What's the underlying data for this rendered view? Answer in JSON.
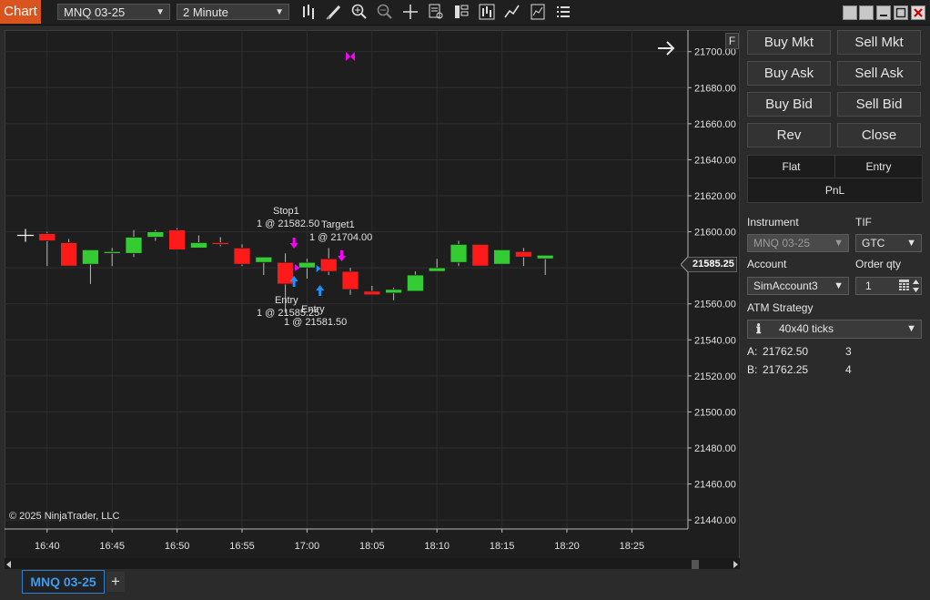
{
  "app": {
    "window_tag": "Chart"
  },
  "toolbar": {
    "instrument": "MNQ 03-25",
    "interval": "2 Minute",
    "icons": [
      "bar-type-icon",
      "draw-pencil-icon",
      "zoom-in-icon",
      "zoom-out-icon",
      "crosshair-icon",
      "data-box-icon",
      "properties-icon",
      "chart-trader-icon",
      "strategies-icon",
      "indicators-icon",
      "menu-list-icon"
    ]
  },
  "window_controls": [
    "window-tile-icon",
    "window-tile-icon",
    "minimize-icon",
    "maximize-icon",
    "close-icon"
  ],
  "chart": {
    "flag_button": "F",
    "copyright": "© 2025 NinjaTrader, LLC",
    "current_price_label": "21585.25",
    "y_ticks": [
      "21700.00",
      "21680.00",
      "21660.00",
      "21640.00",
      "21620.00",
      "21600.00",
      "21580.00",
      "21560.00",
      "21540.00",
      "21520.00",
      "21500.00",
      "21480.00",
      "21460.00",
      "21440.00"
    ],
    "x_ticks": [
      "16:40",
      "16:45",
      "16:50",
      "16:55",
      "17:00",
      "18:05",
      "18:10",
      "18:15",
      "18:20",
      "18:25"
    ],
    "annotations": {
      "stop1_title": "Stop1",
      "stop1_detail": "1 @ 21582.50",
      "target1_title": "Target1",
      "target1_detail": "1 @ 21704.00",
      "entry1_title": "Entry",
      "entry1_detail": "1 @ 21585.25",
      "entry2_title": "Entry",
      "entry2_detail": "1 @ 21581.50"
    },
    "colors": {
      "up": "#33cc33",
      "down": "#ff1a1a",
      "marker_magenta": "#ff00ff",
      "marker_blue": "#1e90ff"
    }
  },
  "chart_data": {
    "type": "candlestick",
    "ylim": [
      21435,
      21712
    ],
    "candles": [
      {
        "o": 21598,
        "h": 21598,
        "l": 21598,
        "c": 21598
      },
      {
        "o": 21599,
        "h": 21600,
        "l": 21581,
        "c": 21595
      },
      {
        "o": 21594,
        "h": 21596,
        "l": 21581,
        "c": 21581
      },
      {
        "o": 21582,
        "h": 21590,
        "l": 21571,
        "c": 21590
      },
      {
        "o": 21588,
        "h": 21591,
        "l": 21581,
        "c": 21589
      },
      {
        "o": 21588,
        "h": 21601,
        "l": 21586,
        "c": 21597
      },
      {
        "o": 21597,
        "h": 21601,
        "l": 21595,
        "c": 21600
      },
      {
        "o": 21601,
        "h": 21602,
        "l": 21590,
        "c": 21590
      },
      {
        "o": 21591,
        "h": 21598,
        "l": 21591,
        "c": 21594
      },
      {
        "o": 21594,
        "h": 21597,
        "l": 21592,
        "c": 21593
      },
      {
        "o": 21591,
        "h": 21593,
        "l": 21581,
        "c": 21582
      },
      {
        "o": 21583,
        "h": 21586,
        "l": 21576,
        "c": 21586
      },
      {
        "o": 21583,
        "h": 21588,
        "l": 21555,
        "c": 21571
      },
      {
        "o": 21580,
        "h": 21585,
        "l": 21574,
        "c": 21583
      },
      {
        "o": 21585,
        "h": 21591,
        "l": 21576,
        "c": 21578
      },
      {
        "o": 21578,
        "h": 21580,
        "l": 21565,
        "c": 21568
      },
      {
        "o": 21567,
        "h": 21570,
        "l": 21565,
        "c": 21565
      },
      {
        "o": 21566,
        "h": 21569,
        "l": 21562,
        "c": 21568
      },
      {
        "o": 21567,
        "h": 21578,
        "l": 21567,
        "c": 21576
      },
      {
        "o": 21578,
        "h": 21585,
        "l": 21578,
        "c": 21580
      },
      {
        "o": 21583,
        "h": 21595,
        "l": 21581,
        "c": 21593
      },
      {
        "o": 21593,
        "h": 21593,
        "l": 21581,
        "c": 21581
      },
      {
        "o": 21582,
        "h": 21590,
        "l": 21582,
        "c": 21590
      },
      {
        "o": 21589,
        "h": 21591,
        "l": 21581,
        "c": 21586
      },
      {
        "o": 21585,
        "h": 21587,
        "l": 21576,
        "c": 21587
      }
    ]
  },
  "trader_panel": {
    "buttons": [
      [
        "Buy Mkt",
        "Sell Mkt"
      ],
      [
        "Buy Ask",
        "Sell Ask"
      ],
      [
        "Buy Bid",
        "Sell Bid"
      ],
      [
        "Rev",
        "Close"
      ]
    ],
    "status": {
      "flat": "Flat",
      "entry": "Entry",
      "pnl": "PnL"
    },
    "instrument_label": "Instrument",
    "instrument_value": "MNQ 03-25",
    "tif_label": "TIF",
    "tif_value": "GTC",
    "account_label": "Account",
    "account_value": "SimAccount3",
    "qty_label": "Order qty",
    "qty_value": "1",
    "atm_label": "ATM Strategy",
    "atm_value": "40x40 ticks",
    "ask_prefix": "A:",
    "ask_price": "21762.50",
    "ask_size": "3",
    "bid_prefix": "B:",
    "bid_price": "21762.25",
    "bid_size": "4"
  },
  "tabs": {
    "active": "MNQ 03-25",
    "add": "+"
  }
}
